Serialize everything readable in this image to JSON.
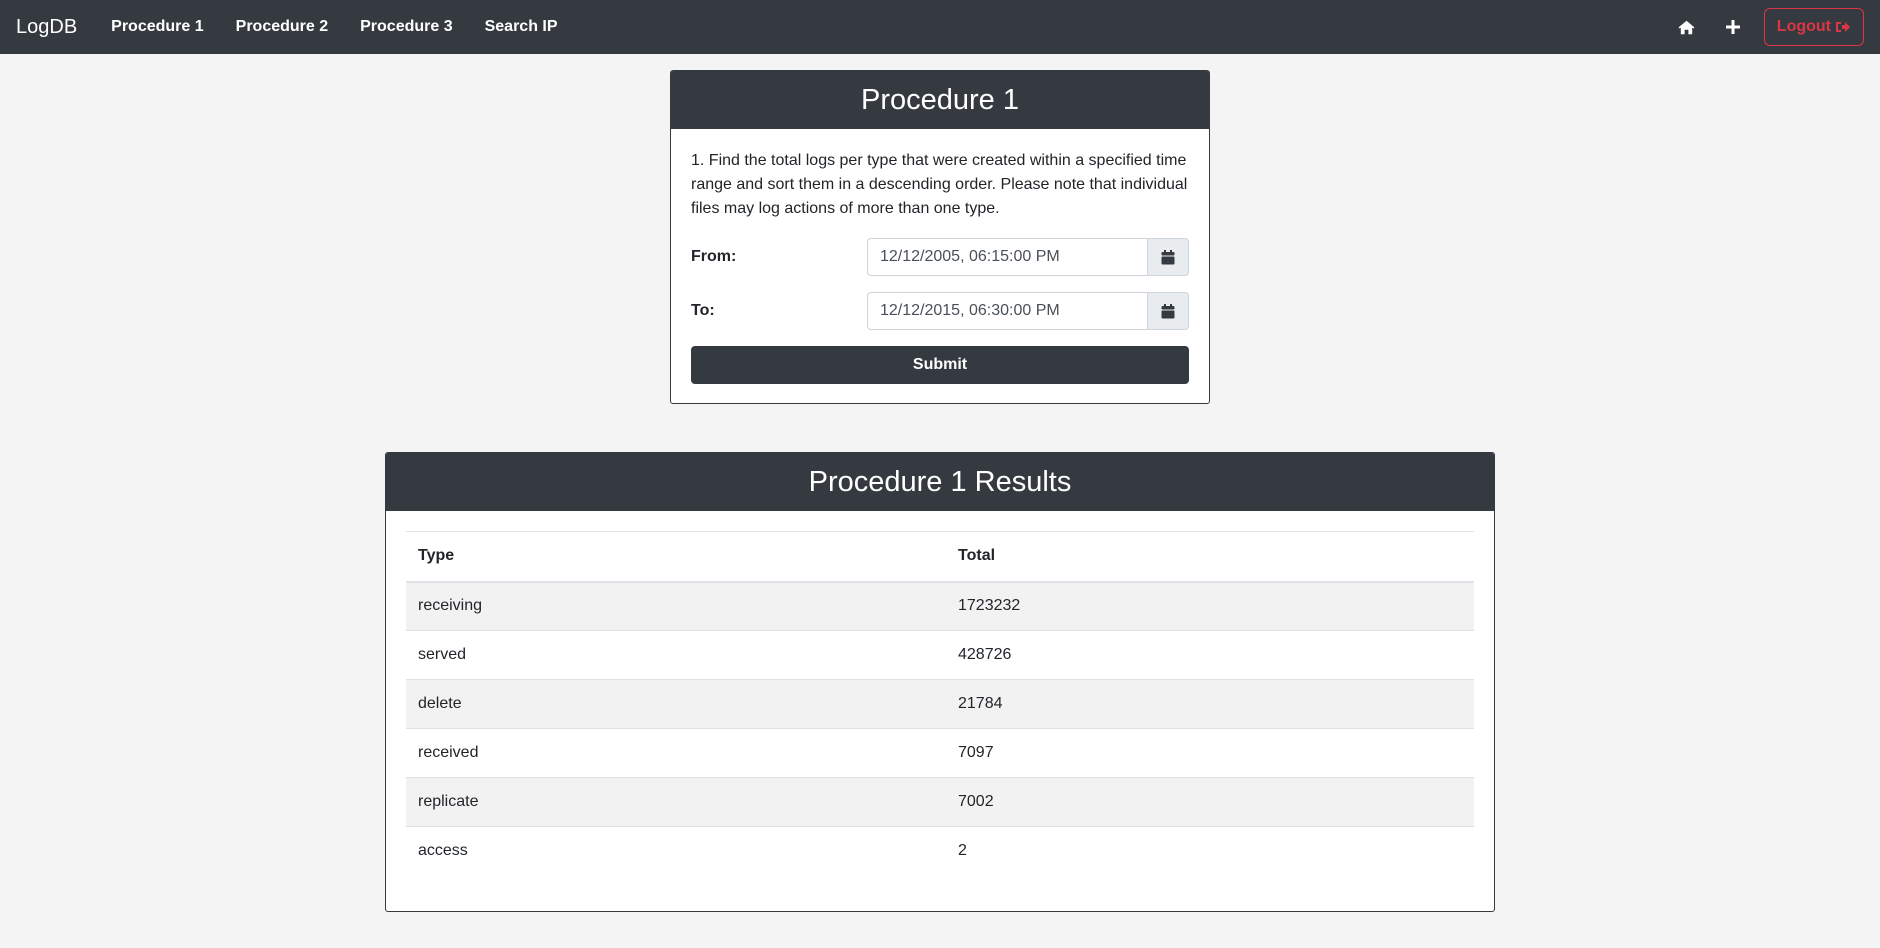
{
  "navbar": {
    "brand": "LogDB",
    "links": [
      "Procedure 1",
      "Procedure 2",
      "Procedure 3",
      "Search IP"
    ],
    "home_icon": "home-icon",
    "add_icon": "plus-icon",
    "logout_label": "Logout",
    "logout_icon": "sign-out-icon",
    "colors": {
      "bar": "#343a40",
      "logout": "#dc3545"
    }
  },
  "form": {
    "title": "Procedure 1",
    "description": "1. Find the total logs per type that were created within a specified time range and sort them in a descending order. Please note that individual files may log actions of more than one type.",
    "from_label": "From:",
    "from_value": "12/12/2005, 06:15:00 PM",
    "to_label": "To:",
    "to_value": "12/12/2015, 06:30:00 PM",
    "calendar_icon": "calendar-icon",
    "submit_label": "Submit"
  },
  "results": {
    "title": "Procedure 1 Results",
    "columns": [
      "Type",
      "Total"
    ],
    "rows": [
      [
        "receiving",
        "1723232"
      ],
      [
        "served",
        "428726"
      ],
      [
        "delete",
        "21784"
      ],
      [
        "received",
        "7097"
      ],
      [
        "replicate",
        "7002"
      ],
      [
        "access",
        "2"
      ]
    ]
  }
}
